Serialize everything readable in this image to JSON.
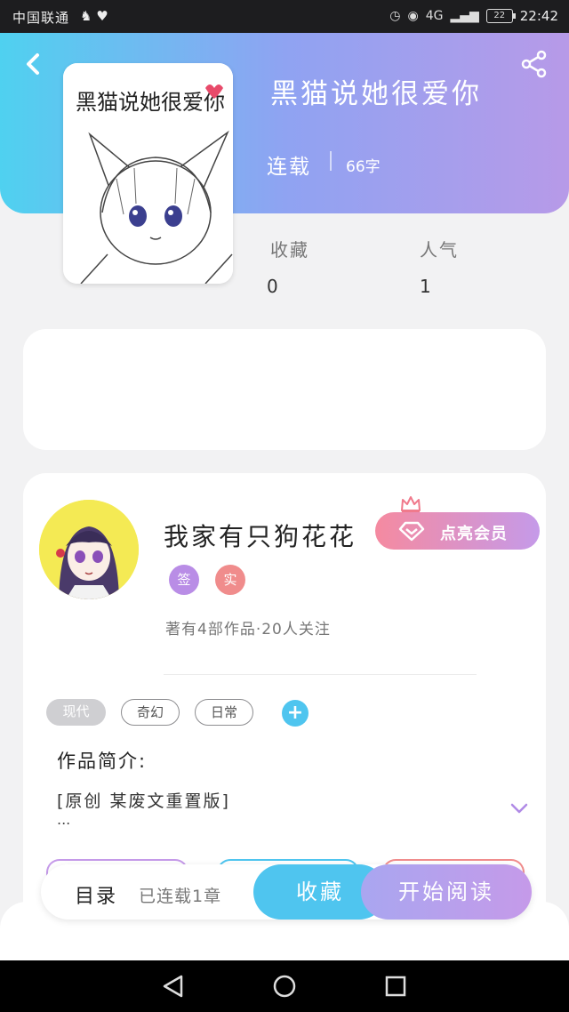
{
  "status_bar": {
    "carrier": "中国联通",
    "network": "4G",
    "battery": "22",
    "time": "22:42"
  },
  "header": {
    "back_icon": "chevron-left-icon",
    "share_icon": "share-icon",
    "cover_title": "黑猫说她很爱你"
  },
  "book": {
    "title": "黑猫说她很爱你",
    "status": "连载",
    "words": "66字",
    "stats": [
      {
        "label": "收藏",
        "value": "0"
      },
      {
        "label": "人气",
        "value": "1"
      }
    ]
  },
  "author": {
    "name": "我家有只狗花花",
    "vip_button": "点亮会员",
    "badges": [
      "签",
      "实"
    ],
    "meta": "著有4部作品·20人关注"
  },
  "tags": {
    "items": [
      "现代",
      "奇幻",
      "日常"
    ],
    "add_icon": "plus-icon",
    "add_label": "+"
  },
  "intro": {
    "title": "作品简介:",
    "text": "[原创  某废文重置版]",
    "more": "...",
    "expand_icon": "chevron-down-icon"
  },
  "bottom_bar": {
    "toc_label": "目录",
    "toc_count": "已连载1章",
    "collect_button": "收藏",
    "read_button": "开始阅读"
  },
  "colors": {
    "gradient_start": "#4fd1f0",
    "gradient_end": "#b79ae8",
    "accent_blue": "#4fc5ef",
    "accent_purple": "#c59ae9",
    "accent_pink": "#f08c8c"
  }
}
